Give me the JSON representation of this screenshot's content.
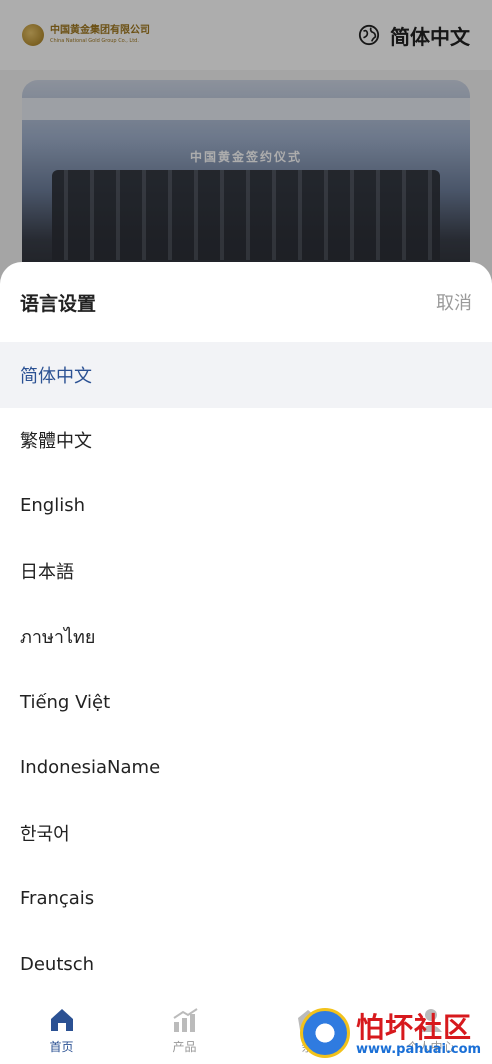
{
  "header": {
    "logo_cn": "中国黄金集团有限公司",
    "logo_en": "China National Gold Group Co., Ltd.",
    "current_language": "简体中文"
  },
  "banner": {
    "title": "中国黄金签约仪式"
  },
  "language_sheet": {
    "title": "语言设置",
    "cancel_label": "取消",
    "options": [
      {
        "label": "简体中文",
        "selected": true
      },
      {
        "label": "繁體中文",
        "selected": false
      },
      {
        "label": "English",
        "selected": false
      },
      {
        "label": "日本語",
        "selected": false
      },
      {
        "label": "ภาษาไทย",
        "selected": false
      },
      {
        "label": "Tiếng Việt",
        "selected": false
      },
      {
        "label": "IndonesiaName",
        "selected": false
      },
      {
        "label": "한국어",
        "selected": false
      },
      {
        "label": "Français",
        "selected": false
      },
      {
        "label": "Deutsch",
        "selected": false
      }
    ]
  },
  "tabbar": {
    "tabs": [
      {
        "label": "首页",
        "icon": "home-icon",
        "active": true
      },
      {
        "label": "产品",
        "icon": "chart-icon",
        "active": false
      },
      {
        "label": "余",
        "icon": "wallet-icon",
        "active": false
      },
      {
        "label": "个人中心",
        "icon": "user-icon",
        "active": false
      }
    ]
  },
  "watermark": {
    "name": "怕坏社区",
    "url": "www.pahuai.com"
  },
  "colors": {
    "accent": "#2b5193",
    "selected_bg": "#f2f3f6",
    "muted": "#9a9a9a",
    "gold": "#a07820"
  }
}
